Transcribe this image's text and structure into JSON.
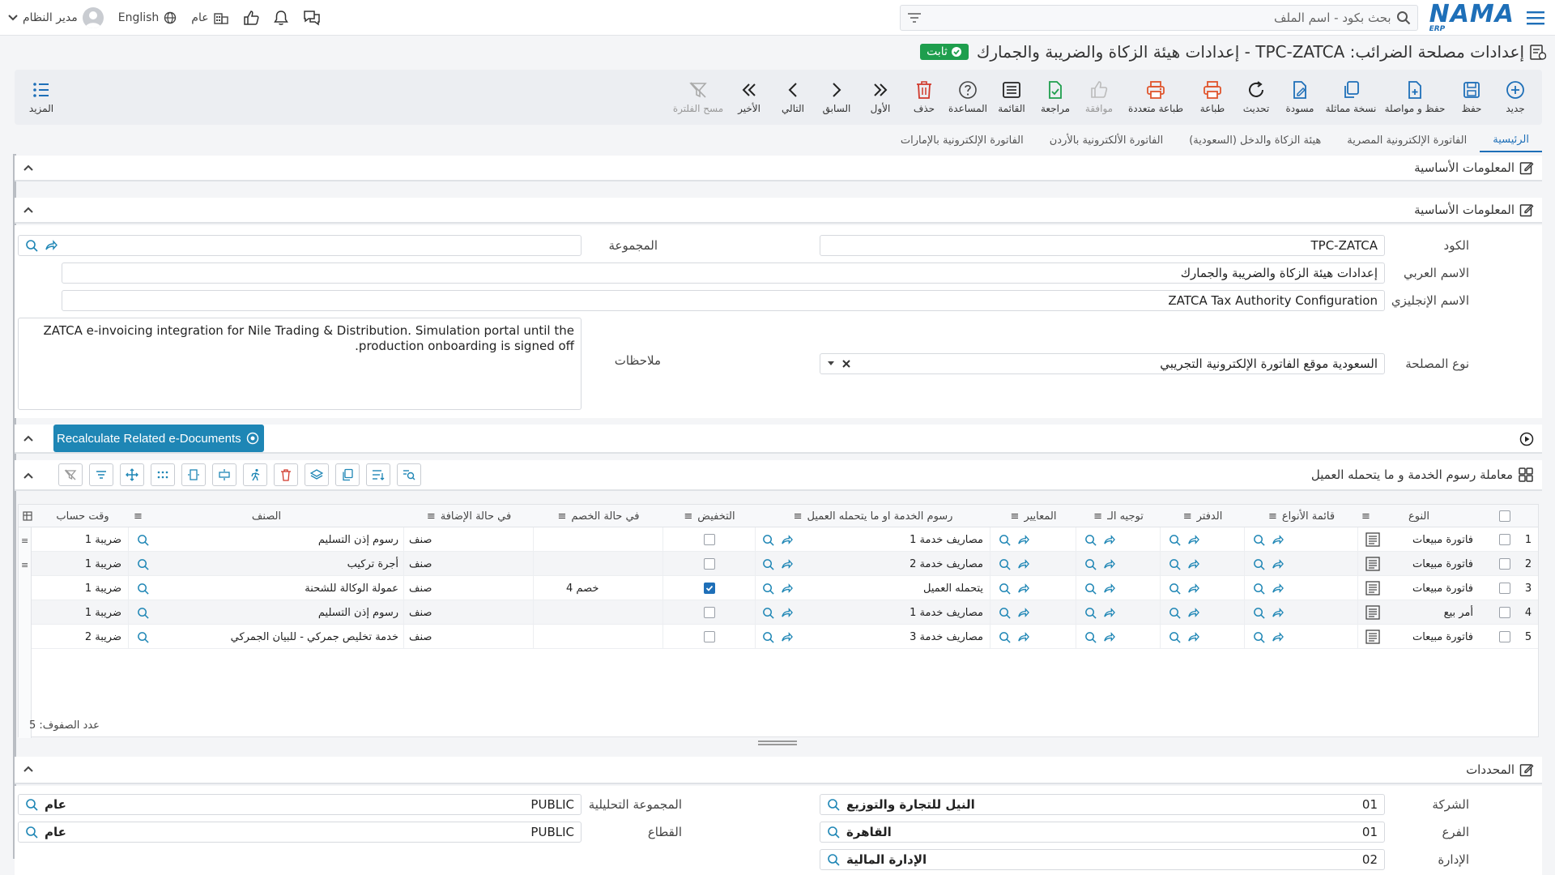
{
  "topbar": {
    "search_placeholder": "بحث بكود - اسم الملف",
    "logo": "NAMA",
    "logo_sub": "ERP",
    "lang": "English",
    "public": "عام",
    "user": "مدير النظام"
  },
  "title": {
    "text": "إعدادات مصلحة الضرائب: TPC-ZATCA - إعدادات هيئة الزكاة والضريبة والجمارك",
    "badge": "ثابت"
  },
  "toolbar": {
    "new": "جديد",
    "save": "حفظ",
    "save_continue": "حفظ و مواصلة",
    "copy": "نسخة مماثلة",
    "draft": "مسودة",
    "refresh": "تحديث",
    "print": "طباعة",
    "multi_print": "طباعة متعددة",
    "approve": "موافقة",
    "review": "مراجعة",
    "list": "القائمة",
    "help": "المساعدة",
    "delete": "حذف",
    "first": "الأول",
    "prev": "السابق",
    "next": "التالي",
    "last": "الأخير",
    "clear_filter": "مسح الفلترة",
    "more": "المزيد"
  },
  "tabs": [
    "الرئيسية",
    "الفاتورة الإلكترونية المصرية",
    "هيئة الزكاة والدخل (السعودية)",
    "الفاتورة الألكترونية بالأردن",
    "الفاتورة الإلكترونية بالإمارات"
  ],
  "sections": {
    "basic_outer": "المعلومات الأساسية",
    "basic_inner": "المعلومات الأساسية",
    "fees": "معاملة رسوم الخدمة و ما يتحمله العميل",
    "dimensions": "المحددات"
  },
  "form": {
    "code_label": "الكود",
    "code": "TPC-ZATCA",
    "group_label": "المجموعة",
    "group": "",
    "arabic_label": "الاسم العربي",
    "arabic": "إعدادات هيئة الزكاة والضريبة والجمارك",
    "english_label": "الاسم الإنجليزي",
    "english": "ZATCA Tax Authority Configuration",
    "type_label": "نوع المصلحة",
    "type": "السعودية موقع الفاتورة الإلكترونية التجريبي",
    "notes_label": "ملاحظات",
    "notes": "ZATCA e-invoicing integration for Nile Trading & Distribution. Simulation portal until the production onboarding is signed off."
  },
  "recalc_button": "Recalculate Related e-Documents",
  "grid": {
    "headers": {
      "type": "النوع",
      "types_list": "قائمة الأنواع",
      "book": "الدفتر",
      "direction": "توجيه الـ",
      "criteria": "المعايير",
      "fees": "رسوم الخدمة او ما يتحمله العميل",
      "discount": "التخفيض",
      "on_discount": "في حالة الخصم",
      "on_add": "في حالة الإضافة",
      "item": "الصنف",
      "tax_time": "وقت حساب"
    },
    "rows": [
      {
        "n": "1",
        "type": "فاتورة مبيعات",
        "fees": "مصاريف خدمة 1",
        "discount": false,
        "on_discount": "",
        "on_add": "صنف",
        "item": "رسوم إذن التسليم",
        "tax": "ضريبة 1"
      },
      {
        "n": "2",
        "type": "فاتورة مبيعات",
        "fees": "مصاريف خدمة 2",
        "discount": false,
        "on_discount": "",
        "on_add": "صنف",
        "item": "أجرة تركيب",
        "tax": "ضريبة 1"
      },
      {
        "n": "3",
        "type": "فاتورة مبيعات",
        "fees": "يتحمله العميل",
        "discount": true,
        "on_discount": "خصم 4",
        "on_add": "صنف",
        "item": "عمولة الوكالة للشحنة",
        "tax": "ضريبة 1"
      },
      {
        "n": "4",
        "type": "أمر بيع",
        "fees": "مصاريف خدمة 1",
        "discount": false,
        "on_discount": "",
        "on_add": "صنف",
        "item": "رسوم إذن التسليم",
        "tax": "ضريبة 1"
      },
      {
        "n": "5",
        "type": "فاتورة مبيعات",
        "fees": "مصاريف خدمة 3",
        "discount": false,
        "on_discount": "",
        "on_add": "صنف",
        "item": "خدمة تخليص جمركي - للبيان الجمركي",
        "tax": "ضريبة 2"
      }
    ],
    "row_count": "عدد الصفوف: 5"
  },
  "dims": {
    "company_label": "الشركة",
    "company_code": "01",
    "company_name": "النيل للتجارة والتوزيع",
    "branch_label": "الفرع",
    "branch_code": "01",
    "branch_name": "القاهرة",
    "dept_label": "الإدارة",
    "dept_code": "02",
    "dept_name": "الإدارة المالية",
    "analytic_label": "المجموعة التحليلية",
    "analytic_code": "PUBLIC",
    "analytic_name": "عام",
    "sector_label": "القطاع",
    "sector_code": "PUBLIC",
    "sector_name": "عام"
  }
}
